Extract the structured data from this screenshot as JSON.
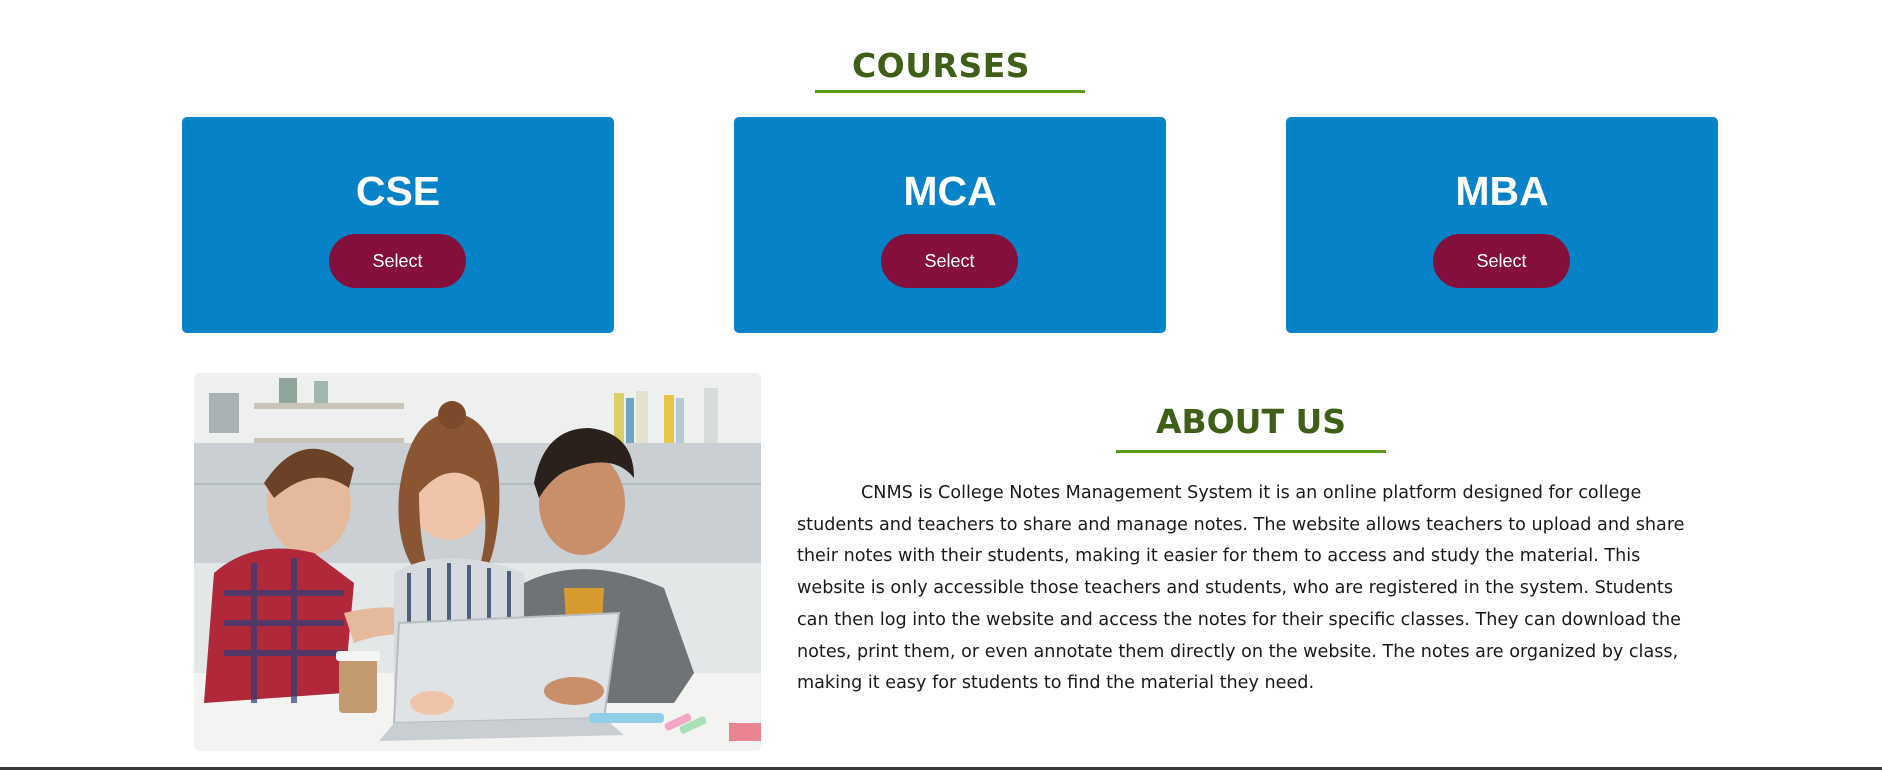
{
  "courses": {
    "title": "COURSES",
    "items": [
      {
        "name": "CSE",
        "button_label": "Select"
      },
      {
        "name": "MCA",
        "button_label": "Select"
      },
      {
        "name": "MBA",
        "button_label": "Select"
      }
    ]
  },
  "about": {
    "title": "ABOUT US",
    "text": "CNMS is College Notes Management System it is an online platform designed for college students and teachers to share and manage notes. The website allows teachers to upload and share their notes with their students, making it easier for them to access and study the material. This website is only accessible those teachers and students, who are registered in the system. Students can then log into the website and access the notes for their specific classes. They can download the notes, print them, or even annotate them directly on the website. The notes are organized by class, making it easy for students to find the material they need.",
    "image": "students-with-laptop-photo"
  },
  "colors": {
    "heading": "#3f5e17",
    "underline": "#5e9a1a",
    "card": "#0582c8",
    "button": "#850f3c"
  }
}
